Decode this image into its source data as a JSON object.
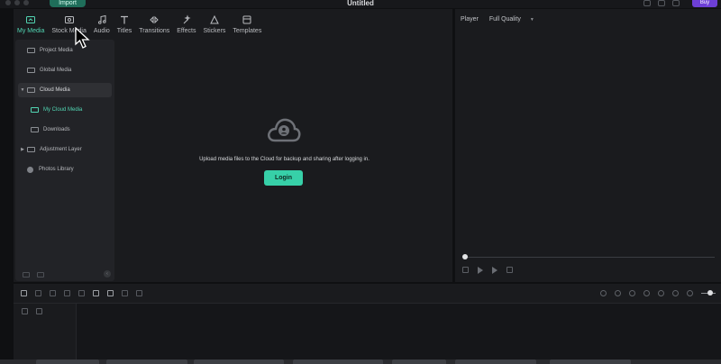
{
  "titlebar": {
    "import_label": "Import",
    "doc_title": "Untitled",
    "buy_label": "Buy"
  },
  "toolbar": {
    "items": [
      {
        "label": "My Media",
        "icon": "my-media-icon",
        "active": true
      },
      {
        "label": "Stock Media",
        "icon": "stock-media-icon",
        "active": false
      },
      {
        "label": "Audio",
        "icon": "music-note-icon",
        "active": false
      },
      {
        "label": "Titles",
        "icon": "titles-icon",
        "active": false
      },
      {
        "label": "Transitions",
        "icon": "transitions-icon",
        "active": false
      },
      {
        "label": "Effects",
        "icon": "effects-icon",
        "active": false
      },
      {
        "label": "Stickers",
        "icon": "stickers-icon",
        "active": false
      },
      {
        "label": "Templates",
        "icon": "templates-icon",
        "active": false
      }
    ],
    "accent_color": "#52d6b3"
  },
  "sidebar": {
    "items": [
      {
        "label": "Project Media",
        "icon": "folder-icon"
      },
      {
        "label": "Global Media",
        "icon": "folder-icon"
      },
      {
        "label": "Cloud Media",
        "icon": "folder-icon",
        "expanded": true,
        "selected": true
      },
      {
        "label": "My Cloud Media",
        "icon": "folder-icon",
        "active": true
      },
      {
        "label": "Downloads",
        "icon": "folder-icon"
      },
      {
        "label": "Adjustment Layer",
        "icon": "folder-icon",
        "collapsed": true
      },
      {
        "label": "Photos Library",
        "icon": "photos-icon"
      }
    ]
  },
  "media": {
    "upload_message": "Upload media files to the Cloud for backup and sharing after logging in.",
    "login_label": "Login",
    "login_color": "#37d0a8"
  },
  "player": {
    "label": "Player",
    "quality": "Full Quality"
  }
}
